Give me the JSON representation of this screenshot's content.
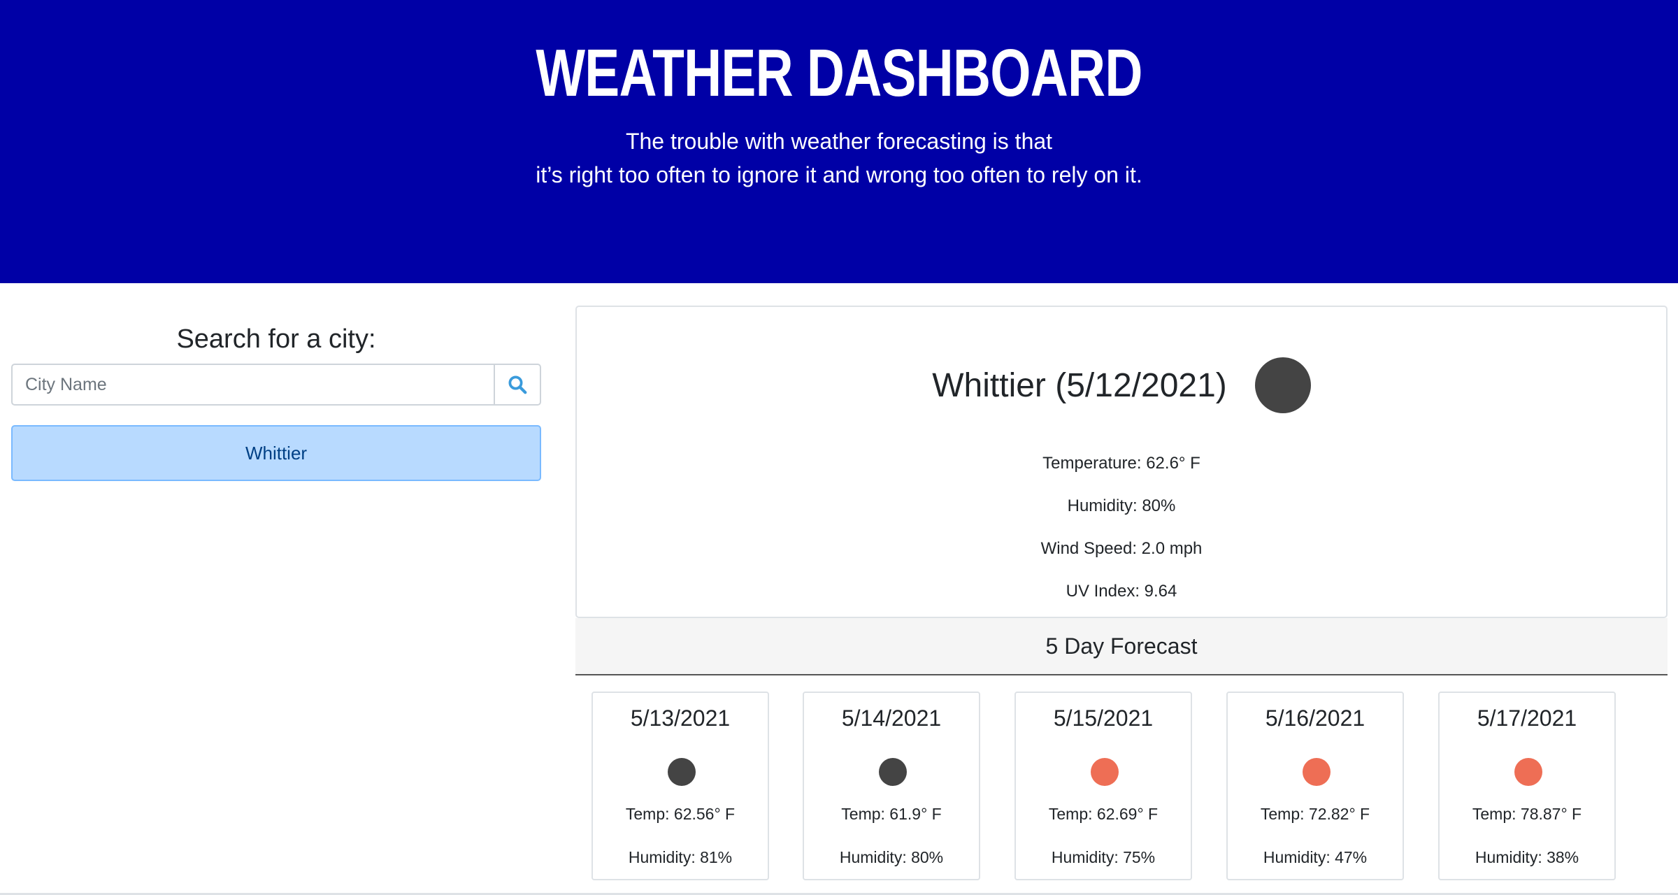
{
  "header": {
    "title": "WEATHER DASHBOARD",
    "quote_line1": "The trouble with weather forecasting is that",
    "quote_line2": "it’s right too often to ignore it and wrong too often to rely on it.",
    "background_color": "#0000a6"
  },
  "search": {
    "heading": "Search for a city:",
    "placeholder": "City Name",
    "button_icon": "search-icon",
    "history": [
      "Whittier"
    ]
  },
  "current": {
    "city_date": "Whittier (5/12/2021)",
    "icon_color": "#444444",
    "temperature": "Temperature: 62.6° F",
    "humidity": "Humidity: 80%",
    "wind": "Wind Speed: 2.0 mph",
    "uv": "UV Index: 9.64"
  },
  "forecast": {
    "heading": "5 Day Forecast",
    "days": [
      {
        "date": "5/13/2021",
        "icon_color": "#444444",
        "temp": "Temp: 62.56° F",
        "humidity": "Humidity: 81%"
      },
      {
        "date": "5/14/2021",
        "icon_color": "#444444",
        "temp": "Temp: 61.9° F",
        "humidity": "Humidity: 80%"
      },
      {
        "date": "5/15/2021",
        "icon_color": "#ee6e55",
        "temp": "Temp: 62.69° F",
        "humidity": "Humidity: 75%"
      },
      {
        "date": "5/16/2021",
        "icon_color": "#ee6e55",
        "temp": "Temp: 72.82° F",
        "humidity": "Humidity: 47%"
      },
      {
        "date": "5/17/2021",
        "icon_color": "#ee6e55",
        "temp": "Temp: 78.87° F",
        "humidity": "Humidity: 38%"
      }
    ]
  }
}
